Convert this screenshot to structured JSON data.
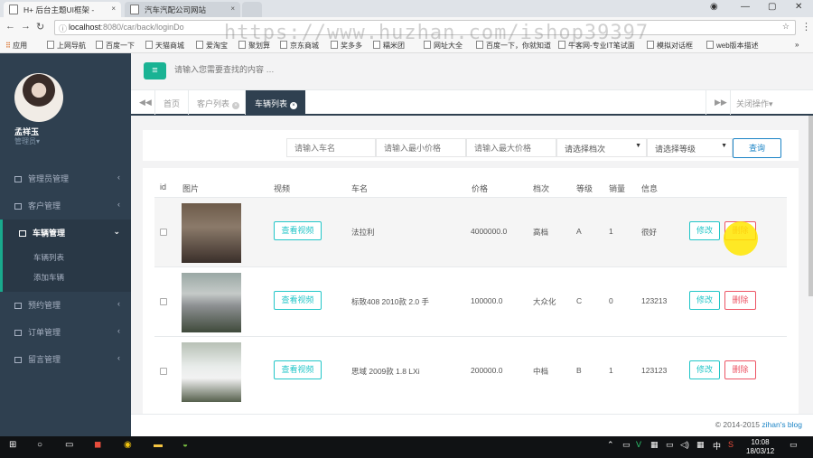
{
  "browser": {
    "tabs": [
      {
        "title": "H+ 后台主题UI框架 - ",
        "close": "×"
      },
      {
        "title": "汽车汽配公司网站",
        "close": "×"
      }
    ],
    "address": {
      "host": "localhost",
      "path": ":8080/car/back/loginDo"
    },
    "bookmarks": [
      "应用",
      "上网导航",
      "百度一下",
      "天猫商城",
      "爱淘宝",
      "聚划算",
      "京东商城",
      "奖多多",
      "糯米团",
      "网址大全",
      "百度一下，你就知道",
      "牛客网-专业IT笔试面",
      "模拟对话框",
      "web版本描述"
    ],
    "watermark": "https://www.huzhan.com/ishop39397"
  },
  "sidebar": {
    "user_name": "孟祥玉",
    "user_role": "管理员▾",
    "menus": [
      {
        "label": "管理员管理",
        "arrow": "‹"
      },
      {
        "label": "客户管理",
        "arrow": "‹"
      },
      {
        "label": "车辆管理",
        "arrow": "⌄"
      },
      {
        "label": "预约管理",
        "arrow": "‹"
      },
      {
        "label": "订单管理",
        "arrow": "‹"
      },
      {
        "label": "留言管理",
        "arrow": "‹"
      }
    ],
    "submenu": [
      "车辆列表",
      "添加车辆"
    ]
  },
  "header": {
    "menu_icon": "≡",
    "search_placeholder": "请输入您需要查找的内容 …"
  },
  "content_tabs": {
    "prev": "◀◀",
    "next": "▶▶",
    "tabs": [
      {
        "label": "首页"
      },
      {
        "label": "客户列表",
        "close": "×"
      },
      {
        "label": "车辆列表",
        "close": "×"
      }
    ],
    "close_ops": "关闭操作▾"
  },
  "filter": {
    "name_placeholder": "请输入车名",
    "min_price_placeholder": "请输入最小价格",
    "max_price_placeholder": "请输入最大价格",
    "grade_select": "请选择档次",
    "level_select": "请选择等级",
    "query_button": "查询"
  },
  "table": {
    "headers": [
      "id",
      "图片",
      "视频",
      "车名",
      "价格",
      "档次",
      "等级",
      "销量",
      "信息"
    ],
    "video_button": "查看视频",
    "edit_button": "修改",
    "delete_button": "删除",
    "rows": [
      {
        "name": "法拉利",
        "price": "4000000.0",
        "grade": "高档",
        "level": "A",
        "sales": "1",
        "info": "很好"
      },
      {
        "name": "标致408 2010款 2.0 手",
        "price": "100000.0",
        "grade": "大众化",
        "level": "C",
        "sales": "0",
        "info": "123213"
      },
      {
        "name": "思域 2009款 1.8 LXi",
        "price": "200000.0",
        "grade": "中档",
        "level": "B",
        "sales": "1",
        "info": "123123"
      }
    ]
  },
  "footer": {
    "copyright": "© 2014-2015 ",
    "blog": "zihan's blog"
  },
  "taskbar": {
    "time": "10:08",
    "date": "18/03/12",
    "ime": "中"
  },
  "colors": {
    "accent": "#1ab394",
    "sidebar": "#2f4050",
    "info": "#23c6c8",
    "danger": "#ed5565",
    "primary": "#1c84c6"
  }
}
